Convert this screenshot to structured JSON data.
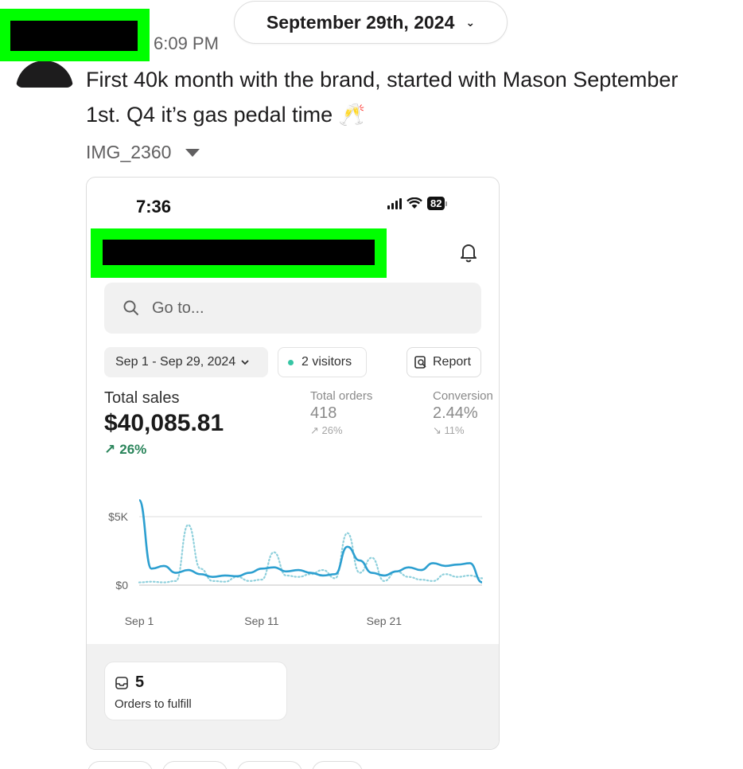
{
  "date_divider": {
    "label": "September 29th, 2024",
    "chevron_icon": "chevron-down-icon"
  },
  "message": {
    "time": "6:09 PM",
    "text": "First 40k month with the brand, started with Mason September 1st. Q4 it’s gas pedal time 🥂",
    "attachment_name": "IMG_2360"
  },
  "phone": {
    "status_time": "7:36",
    "battery": "82",
    "search_placeholder": "Go to...",
    "date_range": "Sep 1 - Sep 29, 2024",
    "visitors": "2 visitors",
    "report_label": "Report",
    "metrics": {
      "total_sales": {
        "label": "Total sales",
        "value": "$40,085.81",
        "change": "26%"
      },
      "total_orders": {
        "label": "Total orders",
        "value": "418",
        "change": "26%"
      },
      "conversion": {
        "label": "Conversion",
        "value": "2.44%",
        "change": "11%"
      }
    },
    "orders_to_fulfill": {
      "count": "5",
      "label": "Orders to fulfill"
    }
  },
  "colors": {
    "accent_green": "#29845a",
    "series_current": "#2c9fd0",
    "series_previous": "#8fd0dc",
    "redaction": "#00ff00"
  },
  "chart_data": {
    "type": "line",
    "x_tick_labels": [
      "Sep 1",
      "Sep 11",
      "Sep 21"
    ],
    "y_tick_labels": [
      "$0",
      "$5K"
    ],
    "ylim": [
      0,
      7000
    ],
    "x": [
      1,
      2,
      3,
      4,
      5,
      6,
      7,
      8,
      9,
      10,
      11,
      12,
      13,
      14,
      15,
      16,
      17,
      18,
      19,
      20,
      21,
      22,
      23,
      24,
      25,
      26,
      27,
      28,
      29
    ],
    "series": [
      {
        "values": [
          6200,
          1200,
          1400,
          900,
          1100,
          800,
          600,
          700,
          650,
          900,
          1200,
          1300,
          1000,
          1100,
          900,
          700,
          800,
          2800,
          1800,
          900,
          700,
          1000,
          1300,
          1100,
          1600,
          1400,
          1500,
          1600,
          200
        ],
        "style": "solid"
      },
      {
        "values": [
          200,
          250,
          200,
          300,
          4400,
          1200,
          300,
          250,
          600,
          300,
          400,
          2400,
          700,
          600,
          800,
          1100,
          500,
          3800,
          900,
          2000,
          300,
          1000,
          600,
          400,
          300,
          800,
          600,
          700,
          500
        ],
        "style": "dotted"
      }
    ],
    "grid": true
  }
}
